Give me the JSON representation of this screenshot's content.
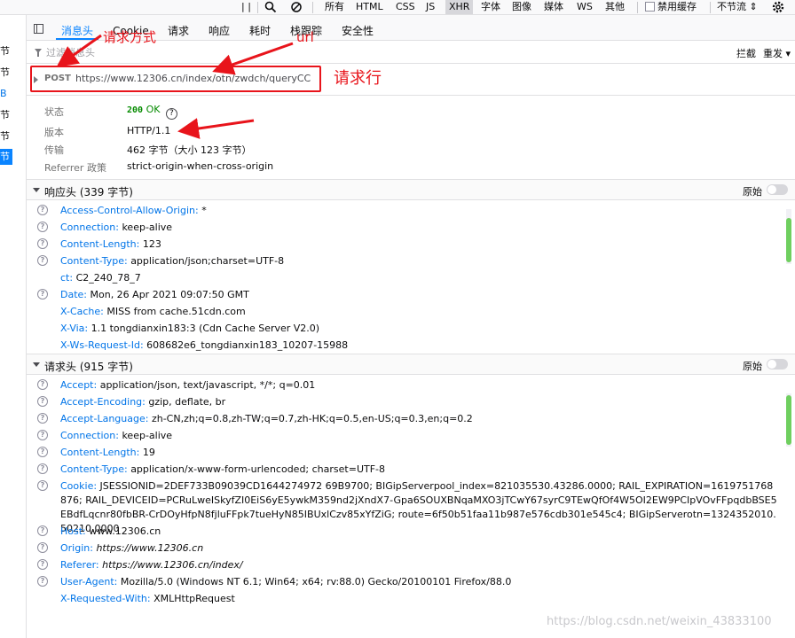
{
  "topbar": {
    "pause": "| |",
    "filter_types": [
      "所有",
      "HTML",
      "CSS",
      "JS",
      "XHR",
      "字体",
      "图像",
      "媒体",
      "WS",
      "其他"
    ],
    "selected_type": "XHR",
    "disable_cache": "禁用缓存",
    "throttle": "不节流 ⇕"
  },
  "sidebar": {
    "items": [
      "节",
      "节",
      "B",
      "节",
      "节",
      "节"
    ]
  },
  "tabs": {
    "items": [
      "消息头",
      "Cookie",
      "请求",
      "响应",
      "耗时",
      "栈跟踪",
      "安全性"
    ],
    "selected": "消息头"
  },
  "filterbar": {
    "placeholder": "过滤消息头",
    "block": "拦截",
    "resend": "重发 ▾"
  },
  "request": {
    "method": "POST",
    "url": "https://www.12306.cn/index/otn/zwdch/queryCC"
  },
  "summary": {
    "status_label": "状态",
    "status_code": "200",
    "status_text": "OK",
    "version_label": "版本",
    "version": "HTTP/1.1",
    "transfer_label": "传输",
    "transfer": "462 字节（大小 123 字节）",
    "referrer_label": "Referrer 政策",
    "referrer": "strict-origin-when-cross-origin"
  },
  "response_headers": {
    "title": "响应头 (339 字节)",
    "raw": "原始",
    "items": [
      {
        "name": "Access-Control-Allow-Origin:",
        "value": "*",
        "help": true
      },
      {
        "name": "Connection:",
        "value": "keep-alive",
        "help": true
      },
      {
        "name": "Content-Length:",
        "value": "123",
        "help": true
      },
      {
        "name": "Content-Type:",
        "value": "application/json;charset=UTF-8",
        "help": true
      },
      {
        "name": "ct:",
        "value": "C2_240_78_7",
        "help": false
      },
      {
        "name": "Date:",
        "value": "Mon, 26 Apr 2021 09:07:50 GMT",
        "help": true
      },
      {
        "name": "X-Cache:",
        "value": "MISS from cache.51cdn.com",
        "help": false
      },
      {
        "name": "X-Via:",
        "value": "1.1 tongdianxin183:3 (Cdn Cache Server V2.0)",
        "help": false
      },
      {
        "name": "X-Ws-Request-Id:",
        "value": "608682e6_tongdianxin183_10207-15988",
        "help": false
      }
    ]
  },
  "request_headers": {
    "title": "请求头 (915 字节)",
    "raw": "原始",
    "items": [
      {
        "name": "Accept:",
        "value": "application/json, text/javascript, */*; q=0.01",
        "help": true
      },
      {
        "name": "Accept-Encoding:",
        "value": "gzip, deflate, br",
        "help": true
      },
      {
        "name": "Accept-Language:",
        "value": "zh-CN,zh;q=0.8,zh-TW;q=0.7,zh-HK;q=0.5,en-US;q=0.3,en;q=0.2",
        "help": true
      },
      {
        "name": "Connection:",
        "value": "keep-alive",
        "help": true
      },
      {
        "name": "Content-Length:",
        "value": "19",
        "help": true
      },
      {
        "name": "Content-Type:",
        "value": "application/x-www-form-urlencoded; charset=UTF-8",
        "help": true
      }
    ],
    "cookie": {
      "name": "Cookie:",
      "value": "JSESSIONID=2DEF733B09039CD1644274972 69B9700; BIGipServerpool_index=821035530.43286.0000; RAIL_EXPIRATION=1619751768876; RAIL_DEVICEID=PCRuLweISkyfZI0EiS6yE5ywkM359nd2jXndX7-Gpa6SOUXBNqaMXO3jTCwY67syrC9TEwQfOf4W5OI2EW9PCIpVOvFFpqdbBSE5EBdfLqcnr80fbBR-CrDOyHfpN8fjluFFpk7tueHyN85IBUxlCzv85xYfZiG; route=6f50b51faa11b987e576cdb301e545c4; BIGipServerotn=1324352010.50210.0000"
    },
    "items_after": [
      {
        "name": "Host:",
        "value": "www.12306.cn",
        "help": true,
        "italic": false
      },
      {
        "name": "Origin:",
        "value": "https://www.12306.cn",
        "help": true,
        "italic": true
      },
      {
        "name": "Referer:",
        "value": "https://www.12306.cn/index/",
        "help": true,
        "italic": true
      },
      {
        "name": "User-Agent:",
        "value": "Mozilla/5.0 (Windows NT 6.1; Win64; x64; rv:88.0) Gecko/20100101 Firefox/88.0",
        "help": true,
        "italic": false
      },
      {
        "name": "X-Requested-With:",
        "value": "XMLHttpRequest",
        "help": false,
        "italic": false
      }
    ]
  },
  "annotations": {
    "method_label": "请求方式",
    "url_label": "url",
    "reqline_label": "请求行"
  },
  "watermark": "https://blog.csdn.net/weixin_43833100",
  "colors": {
    "accent": "#0a84ff",
    "header_name": "#0074e8",
    "status_ok": "#058b00",
    "annotation_red": "#e8141b"
  }
}
